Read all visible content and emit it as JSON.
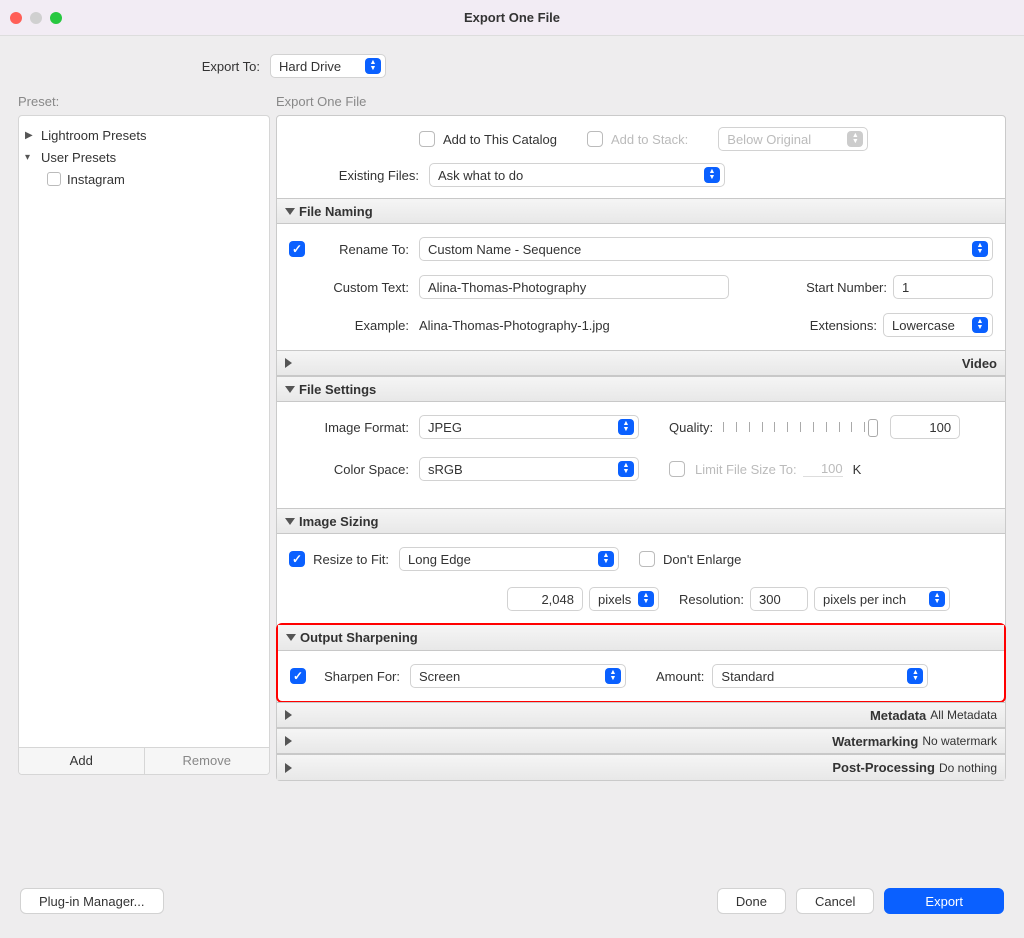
{
  "window": {
    "title": "Export One File"
  },
  "exportTo": {
    "label": "Export To:",
    "value": "Hard Drive"
  },
  "leftHead": "Preset:",
  "rightHead": "Export One File",
  "presets": {
    "group1": "Lightroom Presets",
    "group2": "User Presets",
    "item1": "Instagram",
    "addBtn": "Add",
    "removeBtn": "Remove"
  },
  "topSection": {
    "addCatalog": "Add to This Catalog",
    "addStack": "Add to Stack:",
    "belowOriginal": "Below Original",
    "existingLabel": "Existing Files:",
    "existingValue": "Ask what to do"
  },
  "fileNaming": {
    "header": "File Naming",
    "renameTo": "Rename To:",
    "renameVal": "Custom Name - Sequence",
    "customTextLbl": "Custom Text:",
    "customTextVal": "Alina-Thomas-Photography",
    "startNumLbl": "Start Number:",
    "startNumVal": "1",
    "exampleLbl": "Example:",
    "exampleVal": "Alina-Thomas-Photography-1.jpg",
    "extLbl": "Extensions:",
    "extVal": "Lowercase"
  },
  "video": {
    "header": "Video"
  },
  "fileSettings": {
    "header": "File Settings",
    "imageFmtLbl": "Image Format:",
    "imageFmtVal": "JPEG",
    "qualityLbl": "Quality:",
    "qualityVal": "100",
    "colorSpaceLbl": "Color Space:",
    "colorSpaceVal": "sRGB",
    "limitLbl": "Limit File Size To:",
    "limitVal": "100",
    "limitUnit": "K"
  },
  "imageSizing": {
    "header": "Image Sizing",
    "resizeLbl": "Resize to Fit:",
    "resizeVal": "Long Edge",
    "dontEnlarge": "Don't Enlarge",
    "dimVal": "2,048",
    "dimUnit": "pixels",
    "resLbl": "Resolution:",
    "resVal": "300",
    "resUnit": "pixels per inch"
  },
  "sharpen": {
    "header": "Output Sharpening",
    "sharpenForLbl": "Sharpen For:",
    "sharpenForVal": "Screen",
    "amountLbl": "Amount:",
    "amountVal": "Standard"
  },
  "metadata": {
    "header": "Metadata",
    "summary": "All Metadata"
  },
  "watermark": {
    "header": "Watermarking",
    "summary": "No watermark"
  },
  "postproc": {
    "header": "Post-Processing",
    "summary": "Do nothing"
  },
  "footer": {
    "plugin": "Plug-in Manager...",
    "done": "Done",
    "cancel": "Cancel",
    "export": "Export"
  }
}
